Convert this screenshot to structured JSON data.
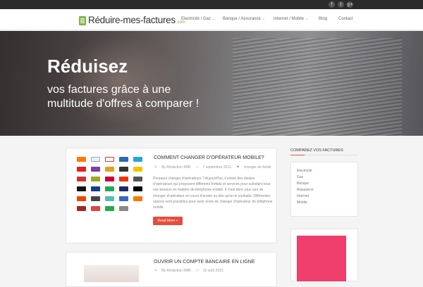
{
  "topbar": {
    "social": [
      {
        "icon": "facebook-icon",
        "glyph": "f"
      },
      {
        "icon": "twitter-icon",
        "glyph": "t"
      },
      {
        "icon": "google-plus-icon",
        "glyph": "g+"
      }
    ]
  },
  "header": {
    "logo_text": "Réduire-mes-factures",
    "logo_tld": ".com",
    "nav": [
      {
        "label": "Electricité / Gaz",
        "has_caret": true
      },
      {
        "label": "Banque / Assurance",
        "has_caret": true
      },
      {
        "label": "Internet / Mobile",
        "has_caret": true
      },
      {
        "label": "Blog",
        "has_caret": false
      },
      {
        "label": "Contact",
        "has_caret": false
      }
    ]
  },
  "hero": {
    "title": "Réduisez",
    "subtitle_line1": "vos factures grâce à une",
    "subtitle_line2": "multitude d'offres à comparer !"
  },
  "posts": [
    {
      "title": "COMMENT CHANGER D'OPÉRATEUR MOBILE?",
      "author": "By Rédaction RMF",
      "date": "7 septembre 2015",
      "tag": "changer de forfait",
      "excerpt": "Pourquoi changer d'opérateurs ? Aujourd'hui, il existe des dizaine d'opérateurs qui proposent différents forfaits et services pour satisfaire tous nos besoins en matière de téléphonie mobile. Il n'est donc plus rare de changer d'opérateur en cours d'année ou dès qu'on le souhaite. Différentes raisons sont possibles pour avoir envie de changer d'opérateur de téléphone mobile",
      "read_more": "Read More »"
    },
    {
      "title": "OUVRIR UN COMPTE BANCAIRE EN LIGNE",
      "author": "By Rédaction RMF",
      "date": "12 août 2015"
    }
  ],
  "sidebar": {
    "title": "COMPAREZ VOS FACTURES",
    "items": [
      "Electricité",
      "Gaz",
      "Banque",
      "Assurance",
      "Internet",
      "Mobile"
    ]
  },
  "colors": {
    "accent": "#e74c3c",
    "logo_green": "#7ab648",
    "ad_pink": "#ef3e6b"
  }
}
